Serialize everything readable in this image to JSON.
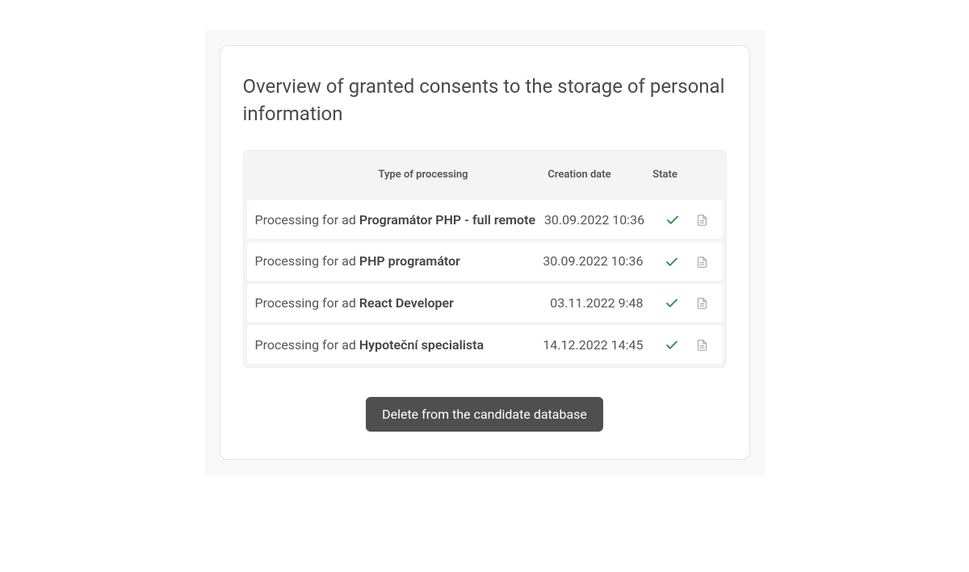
{
  "heading": "Overview of granted consents to the storage of personal information",
  "columns": {
    "type": "Type of processing",
    "date": "Creation date",
    "state": "State"
  },
  "row_prefix": "Processing for ad ",
  "rows": [
    {
      "title": "Programátor PHP - full remote",
      "date": "30.09.2022 10:36",
      "state": "ok"
    },
    {
      "title": "PHP programátor",
      "date": "30.09.2022 10:36",
      "state": "ok"
    },
    {
      "title": "React Developer",
      "date": "03.11.2022 9:48",
      "state": "ok"
    },
    {
      "title": "Hypoteční specialista",
      "date": "14.12.2022 14:45",
      "state": "ok"
    }
  ],
  "actions": {
    "delete": "Delete from the candidate database"
  },
  "icons": {
    "check": "check-icon",
    "doc": "document-icon"
  }
}
